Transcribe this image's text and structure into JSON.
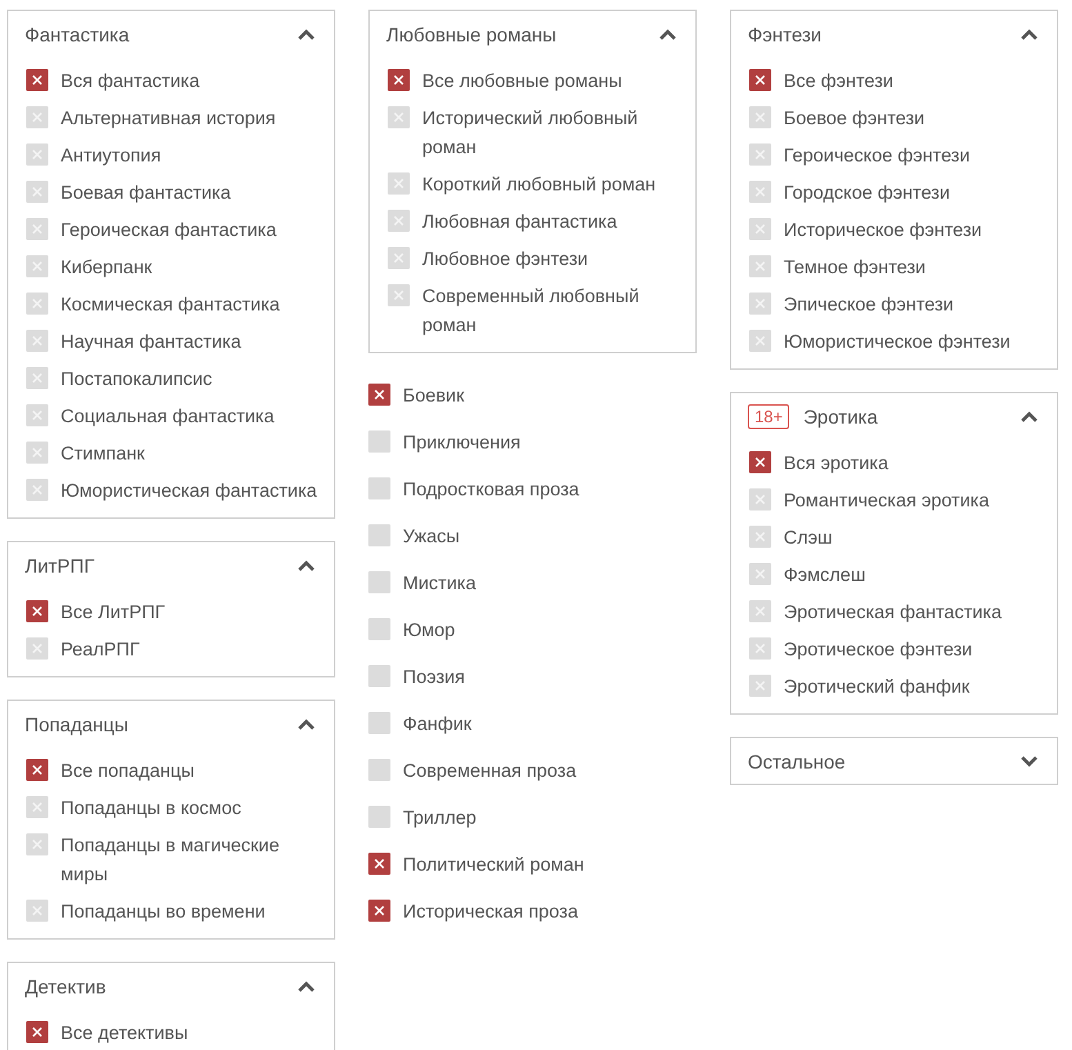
{
  "columns": [
    {
      "blocks": [
        {
          "kind": "panel",
          "title": "Фантастика",
          "expanded": true,
          "items": [
            {
              "label": "Вся фантастика",
              "checked": true
            },
            {
              "label": "Альтернативная история",
              "checked": false
            },
            {
              "label": "Антиутопия",
              "checked": false
            },
            {
              "label": "Боевая фантастика",
              "checked": false
            },
            {
              "label": "Героическая фантастика",
              "checked": false
            },
            {
              "label": "Киберпанк",
              "checked": false
            },
            {
              "label": "Космическая фантастика",
              "checked": false
            },
            {
              "label": "Научная фантастика",
              "checked": false
            },
            {
              "label": "Постапокалипсис",
              "checked": false
            },
            {
              "label": "Социальная фантастика",
              "checked": false
            },
            {
              "label": "Стимпанк",
              "checked": false
            },
            {
              "label": "Юмористическая фантастика",
              "checked": false
            }
          ]
        },
        {
          "kind": "panel",
          "title": "ЛитРПГ",
          "expanded": true,
          "items": [
            {
              "label": "Все ЛитРПГ",
              "checked": true
            },
            {
              "label": "РеалРПГ",
              "checked": false
            }
          ]
        },
        {
          "kind": "panel",
          "title": "Попаданцы",
          "expanded": true,
          "items": [
            {
              "label": "Все попаданцы",
              "checked": true
            },
            {
              "label": "Попаданцы в космос",
              "checked": false
            },
            {
              "label": "Попаданцы в магические миры",
              "checked": false
            },
            {
              "label": "Попаданцы во времени",
              "checked": false
            }
          ]
        },
        {
          "kind": "panel",
          "title": "Детектив",
          "expanded": true,
          "items": [
            {
              "label": "Все детективы",
              "checked": true
            }
          ]
        }
      ]
    },
    {
      "blocks": [
        {
          "kind": "panel",
          "title": "Любовные романы",
          "expanded": true,
          "items": [
            {
              "label": "Все любовные романы",
              "checked": true
            },
            {
              "label": "Исторический любовный роман",
              "checked": false
            },
            {
              "label": "Короткий любовный роман",
              "checked": false
            },
            {
              "label": "Любовная фантастика",
              "checked": false
            },
            {
              "label": "Любовное фэнтези",
              "checked": false
            },
            {
              "label": "Современный любовный роман",
              "checked": false
            }
          ]
        },
        {
          "kind": "list",
          "items": [
            {
              "label": "Боевик",
              "checked": true
            },
            {
              "label": "Приключения",
              "checked": false
            },
            {
              "label": "Подростковая проза",
              "checked": false
            },
            {
              "label": "Ужасы",
              "checked": false
            },
            {
              "label": "Мистика",
              "checked": false
            },
            {
              "label": "Юмор",
              "checked": false
            },
            {
              "label": "Поэзия",
              "checked": false
            },
            {
              "label": "Фанфик",
              "checked": false
            },
            {
              "label": "Современная проза",
              "checked": false
            },
            {
              "label": "Триллер",
              "checked": false
            },
            {
              "label": "Политический роман",
              "checked": true
            },
            {
              "label": "Историческая проза",
              "checked": true
            }
          ]
        }
      ]
    },
    {
      "blocks": [
        {
          "kind": "panel",
          "title": "Фэнтези",
          "expanded": true,
          "items": [
            {
              "label": "Все фэнтези",
              "checked": true
            },
            {
              "label": "Боевое фэнтези",
              "checked": false
            },
            {
              "label": "Героическое фэнтези",
              "checked": false
            },
            {
              "label": "Городское фэнтези",
              "checked": false
            },
            {
              "label": "Историческое фэнтези",
              "checked": false
            },
            {
              "label": "Темное фэнтези",
              "checked": false
            },
            {
              "label": "Эпическое фэнтези",
              "checked": false
            },
            {
              "label": "Юмористическое фэнтези",
              "checked": false
            }
          ]
        },
        {
          "kind": "panel",
          "title": "Эротика",
          "badge": "18+",
          "expanded": true,
          "items": [
            {
              "label": "Вся эротика",
              "checked": true
            },
            {
              "label": "Романтическая эротика",
              "checked": false
            },
            {
              "label": "Слэш",
              "checked": false
            },
            {
              "label": "Фэмслеш",
              "checked": false
            },
            {
              "label": "Эротическая фантастика",
              "checked": false
            },
            {
              "label": "Эротическое фэнтези",
              "checked": false
            },
            {
              "label": "Эротический фанфик",
              "checked": false
            }
          ]
        },
        {
          "kind": "panel",
          "title": "Остальное",
          "expanded": false
        }
      ]
    }
  ]
}
